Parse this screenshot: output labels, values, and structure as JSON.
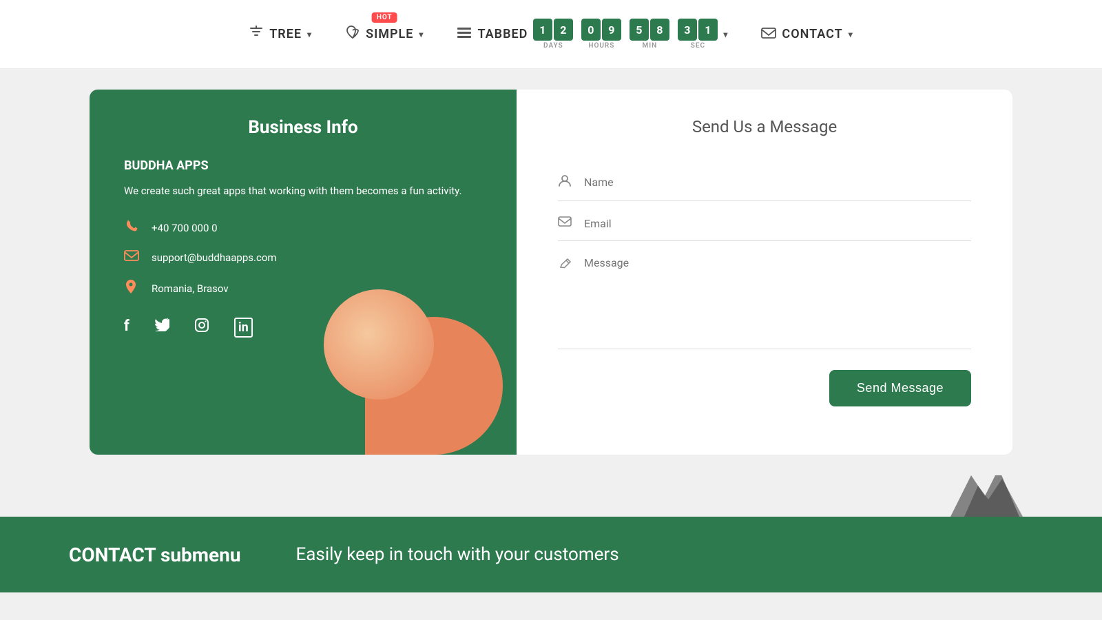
{
  "navbar": {
    "tree_label": "TREE",
    "simple_label": "SIMPLE",
    "tabbed_label": "TABBED",
    "contact_label": "CONTACT",
    "hot_badge": "HOT",
    "countdown": {
      "days": [
        "1",
        "2"
      ],
      "hours": [
        "0",
        "9"
      ],
      "minutes": [
        "5",
        "8"
      ],
      "seconds": [
        "3",
        "1"
      ],
      "days_label": "DAYS",
      "hours_label": "HOURS",
      "min_label": "MIN",
      "sec_label": "SEC"
    }
  },
  "business": {
    "panel_title": "Business Info",
    "company_name": "BUDDHA APPS",
    "description": "We create such great apps that working with them becomes a fun activity.",
    "phone": "+40 700 000 0",
    "email": "support@buddhaapps.com",
    "location": "Romania, Brasov"
  },
  "form": {
    "title": "Send Us a Message",
    "name_placeholder": "Name",
    "email_placeholder": "Email",
    "message_placeholder": "Message",
    "send_button": "Send Message"
  },
  "footer": {
    "title": "CONTACT submenu",
    "subtitle": "Easily keep in touch with your customers"
  },
  "icons": {
    "tree": "⊞",
    "simple": "♡",
    "tabbed": "☰",
    "contact": "✉",
    "phone": "📞",
    "email": "✉",
    "location": "📍",
    "name_field": "👤",
    "email_field": "✉",
    "message_field": "✏",
    "facebook": "f",
    "twitter": "t",
    "instagram": "◎",
    "linkedin": "in"
  }
}
